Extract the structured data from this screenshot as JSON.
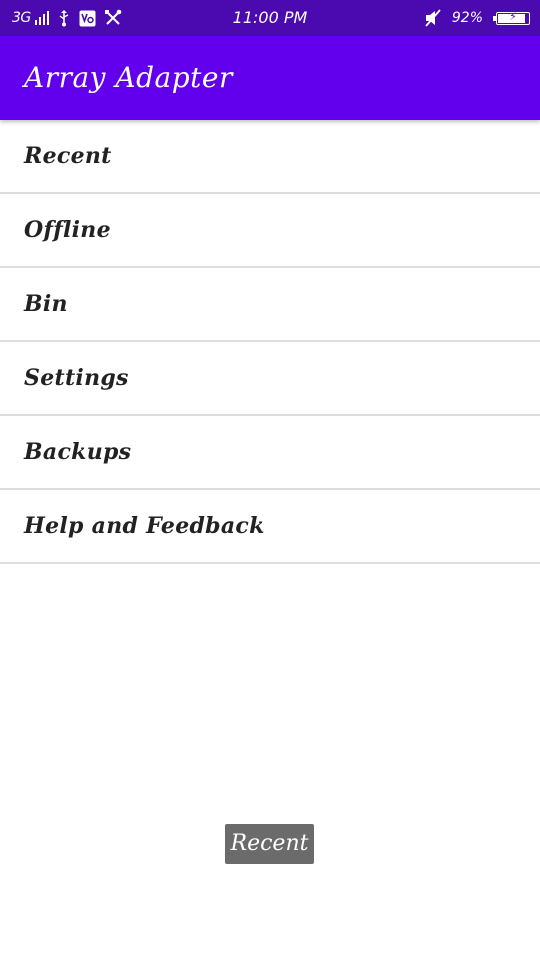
{
  "status_bar": {
    "network": "3G",
    "time": "11:00 PM",
    "battery_percent": "92%",
    "battery_level": 0.92,
    "left_icons": [
      "signal-icon",
      "usb-icon",
      "vo-icon",
      "tools-icon"
    ],
    "right_icons": [
      "mute-icon",
      "battery-icon"
    ]
  },
  "app_bar": {
    "title": "Array Adapter",
    "color": "#6200ee"
  },
  "list": {
    "items": [
      {
        "label": "Recent"
      },
      {
        "label": "Offline"
      },
      {
        "label": "Bin"
      },
      {
        "label": "Settings"
      },
      {
        "label": "Backups"
      },
      {
        "label": "Help and Feedback"
      }
    ]
  },
  "toast": {
    "text": "Recent"
  }
}
